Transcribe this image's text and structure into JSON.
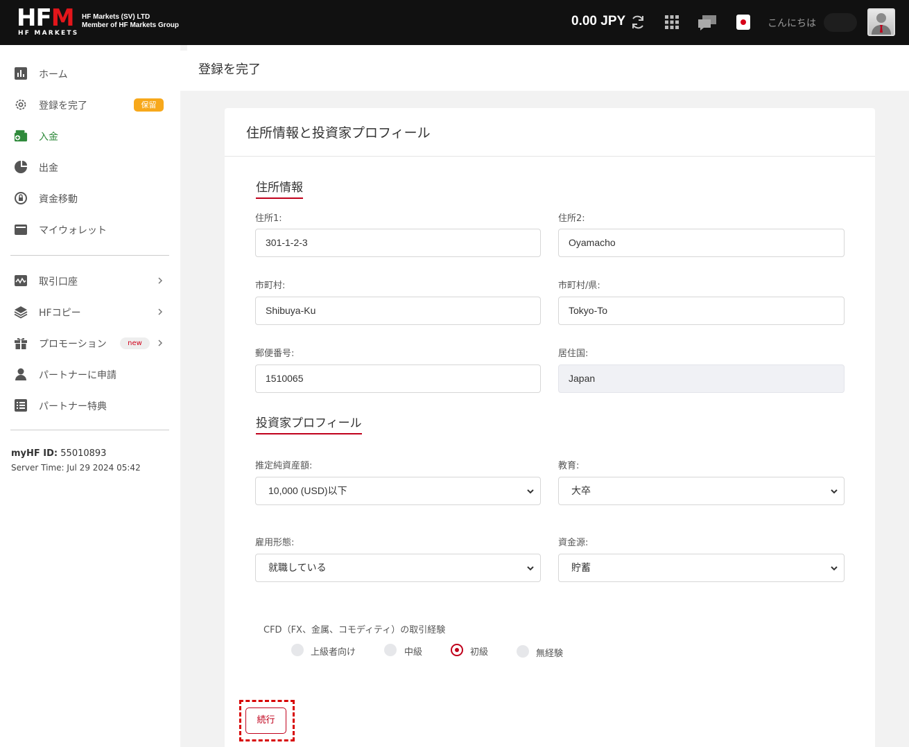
{
  "header": {
    "logo_text_left": "HF",
    "logo_text_red": "M",
    "logo_sub": "HF MARKETS",
    "company_line1": "HF Markets (SV) LTD",
    "company_line2": "Member of HF Markets Group",
    "balance": "0.00 JPY",
    "greeting": "こんにちは"
  },
  "sidebar": {
    "items": [
      {
        "label": "ホーム",
        "icon": "chart-icon"
      },
      {
        "label": "登録を完了",
        "icon": "gear-icon",
        "badge": "保留"
      },
      {
        "label": "入金",
        "icon": "deposit-wallet-icon",
        "active": true
      },
      {
        "label": "出金",
        "icon": "withdraw-icon"
      },
      {
        "label": "資金移動",
        "icon": "transfer-icon"
      },
      {
        "label": "マイウォレット",
        "icon": "wallet-icon"
      },
      {
        "label": "取引口座",
        "icon": "trading-chart-icon"
      },
      {
        "label": "HFコピー",
        "icon": "layers-icon"
      },
      {
        "label": "プロモーション",
        "icon": "gift-icon",
        "badge": "new"
      },
      {
        "label": "パートナーに申請",
        "icon": "person-icon"
      },
      {
        "label": "パートナー特典",
        "icon": "list-icon"
      }
    ],
    "myhf_label": "myHF ID:",
    "myhf_id": " 55010893",
    "server_time": "Server Time: Jul 29 2024 05:42"
  },
  "page": {
    "title": "登録を完了"
  },
  "card": {
    "title": "住所情報と投資家プロフィール",
    "address_section": "住所情報",
    "fields": {
      "address1": {
        "label": "住所1:",
        "value": "301-1-2-3"
      },
      "address2": {
        "label": "住所2:",
        "value": "Oyamacho"
      },
      "city": {
        "label": "市町村:",
        "value": "Shibuya-Ku"
      },
      "prefecture": {
        "label": "市町村/県:",
        "value": "Tokyo-To"
      },
      "postal": {
        "label": "郵便番号:",
        "value": "1510065"
      },
      "country": {
        "label": "居住国:",
        "value": "Japan"
      }
    },
    "investor_section": "投資家プロフィール",
    "selects": {
      "net_worth": {
        "label": "推定純資産額:",
        "value": "10,000 (USD)以下"
      },
      "education": {
        "label": "教育:",
        "value": "大卒"
      },
      "employment": {
        "label": "雇用形態:",
        "value": "就職している"
      },
      "fund_source": {
        "label": "資金源:",
        "value": "貯蓄"
      }
    },
    "experience": {
      "label": "CFD（FX、金属、コモディティ）の取引経験",
      "options": [
        "上級者向け",
        "中級",
        "初級",
        "無経験"
      ],
      "selected": "初級"
    },
    "continue_label": "続行"
  },
  "colors": {
    "accent_red": "#c0001b",
    "active_green": "#2f8a3b",
    "badge_orange": "#f7a81b"
  }
}
